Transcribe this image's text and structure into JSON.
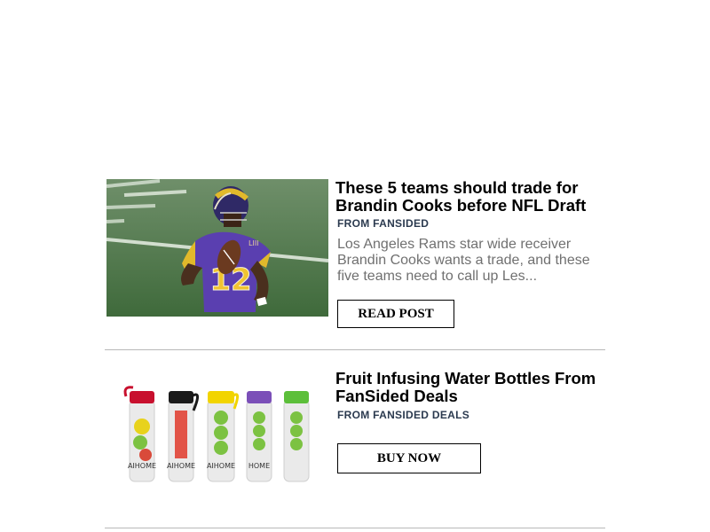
{
  "posts": [
    {
      "title": "These 5 teams should trade for Brandin Cooks before NFL Draft",
      "source": "FROM FANSIDED",
      "description": "Los Angeles Rams star wide receiver Brandin Cooks wants a trade, and these five teams need to call up Les...",
      "button_label": "READ POST",
      "image": {
        "jersey_number": "12"
      }
    },
    {
      "title": "Fruit Infusing Water Bottles From FanSided Deals",
      "source": "FROM FANSIDED DEALS",
      "button_label": "BUY NOW",
      "image": {
        "bottle_text": "AIHOME",
        "bottle_text_cropped": "HOME",
        "lid_colors": [
          "#c8102e",
          "#1a1a1a",
          "#f2d400",
          "#7b4fb8",
          "#5cbf3a"
        ]
      }
    }
  ]
}
